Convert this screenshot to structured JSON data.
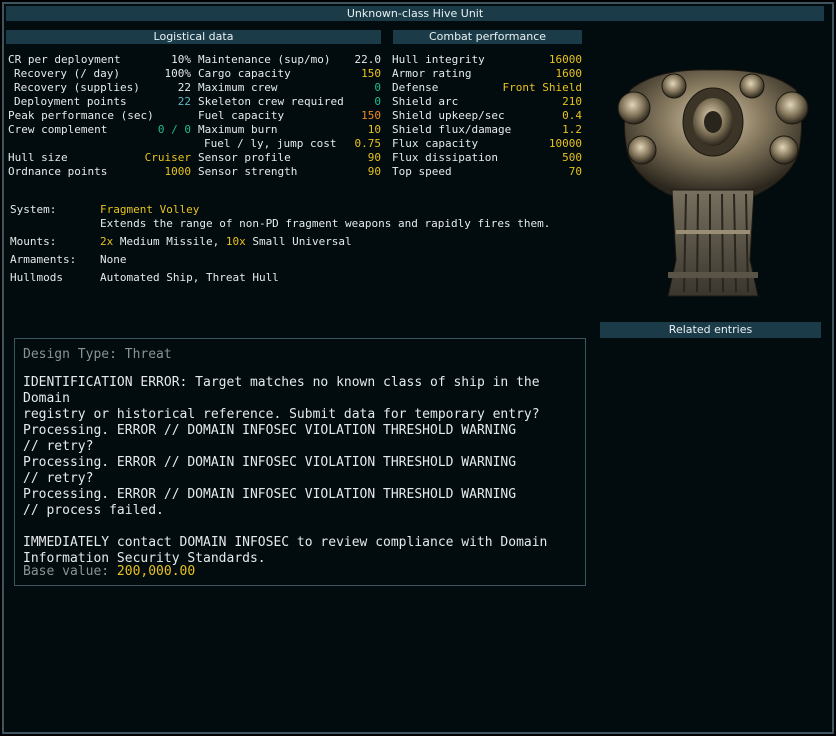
{
  "title": "Unknown-class Hive Unit",
  "logistical": {
    "header": "Logistical data",
    "col1": [
      {
        "label": "CR per deployment",
        "value": "10%",
        "color": "w",
        "indent": 0
      },
      {
        "label": "Recovery (/ day)",
        "value": "100%",
        "color": "w",
        "indent": 1
      },
      {
        "label": "Recovery (supplies)",
        "value": "22",
        "color": "w",
        "indent": 1
      },
      {
        "label": "Deployment points",
        "value": "22",
        "color": "c",
        "indent": 1
      },
      {
        "label": "Peak performance (sec)",
        "value": "",
        "color": "w",
        "indent": 0
      },
      {
        "label": "Crew complement",
        "value": "0 / 0",
        "color": "g",
        "indent": 0
      },
      {
        "label": "",
        "value": "",
        "color": "w",
        "indent": 0
      },
      {
        "label": "Hull size",
        "value": "Cruiser",
        "color": "y",
        "indent": 0
      },
      {
        "label": "Ordnance points",
        "value": "1000",
        "color": "y",
        "indent": 0
      }
    ],
    "col2": [
      {
        "label": "Maintenance (sup/mo)",
        "value": "22.0",
        "color": "w"
      },
      {
        "label": "Cargo capacity",
        "value": "150",
        "color": "y"
      },
      {
        "label": "Maximum crew",
        "value": "0",
        "color": "g"
      },
      {
        "label": "Skeleton crew required",
        "value": "0",
        "color": "g"
      },
      {
        "label": "Fuel capacity",
        "value": "150",
        "color": "o"
      },
      {
        "label": "Maximum burn",
        "value": "10",
        "color": "y"
      },
      {
        "label": "Fuel / ly, jump cost",
        "value": "0.75",
        "color": "y",
        "indent": 1
      },
      {
        "label": "Sensor profile",
        "value": "90",
        "color": "y"
      },
      {
        "label": "Sensor strength",
        "value": "90",
        "color": "y"
      }
    ]
  },
  "combat": {
    "header": "Combat performance",
    "rows": [
      {
        "label": "Hull integrity",
        "value": "16000",
        "color": "y"
      },
      {
        "label": "Armor rating",
        "value": "1600",
        "color": "y"
      },
      {
        "label": "Defense",
        "value": "Front Shield",
        "color": "y"
      },
      {
        "label": "Shield arc",
        "value": "210",
        "color": "y"
      },
      {
        "label": "Shield upkeep/sec",
        "value": "0.4",
        "color": "y"
      },
      {
        "label": "Shield flux/damage",
        "value": "1.2",
        "color": "y"
      },
      {
        "label": "Flux capacity",
        "value": "10000",
        "color": "y"
      },
      {
        "label": "Flux dissipation",
        "value": "500",
        "color": "y"
      },
      {
        "label": "Top speed",
        "value": "70",
        "color": "y"
      }
    ]
  },
  "system": {
    "system_label": "System:",
    "system_name": "Fragment Volley",
    "system_desc": "Extends the range of non-PD fragment weapons and rapidly fires them.",
    "mounts_label": "Mounts:",
    "mounts_count1": "2x",
    "mounts_text1": " Medium Missile, ",
    "mounts_count2": "10x",
    "mounts_text2": " Small Universal",
    "armaments_label": "Armaments:",
    "armaments_value": "None",
    "hullmods_label": "Hullmods",
    "hullmods_value": "Automated Ship, Threat Hull"
  },
  "related": {
    "header": "Related entries"
  },
  "description": {
    "design_type_label": "Design Type: ",
    "design_type_value": "Threat",
    "text": "IDENTIFICATION ERROR: Target matches no known class of ship in the Domain\nregistry or historical reference. Submit data for temporary entry?\nProcessing. ERROR // DOMAIN INFOSEC VIOLATION THRESHOLD WARNING\n// retry?\nProcessing. ERROR // DOMAIN INFOSEC VIOLATION THRESHOLD WARNING\n// retry?\nProcessing. ERROR // DOMAIN INFOSEC VIOLATION THRESHOLD WARNING\n// process failed.\n\nIMMEDIATELY contact DOMAIN INFOSEC to review compliance with Domain\nInformation Security Standards.",
    "base_value_label": "Base value: ",
    "base_value": "200,000.00"
  },
  "colors": {
    "yellow": "#e8c21e",
    "orange": "#f08a1c",
    "green": "#1fbd8d",
    "cyan": "#5fb8c8",
    "header_bg": "#1a3b47"
  },
  "ship_image": "hive-unit-ship-sprite"
}
